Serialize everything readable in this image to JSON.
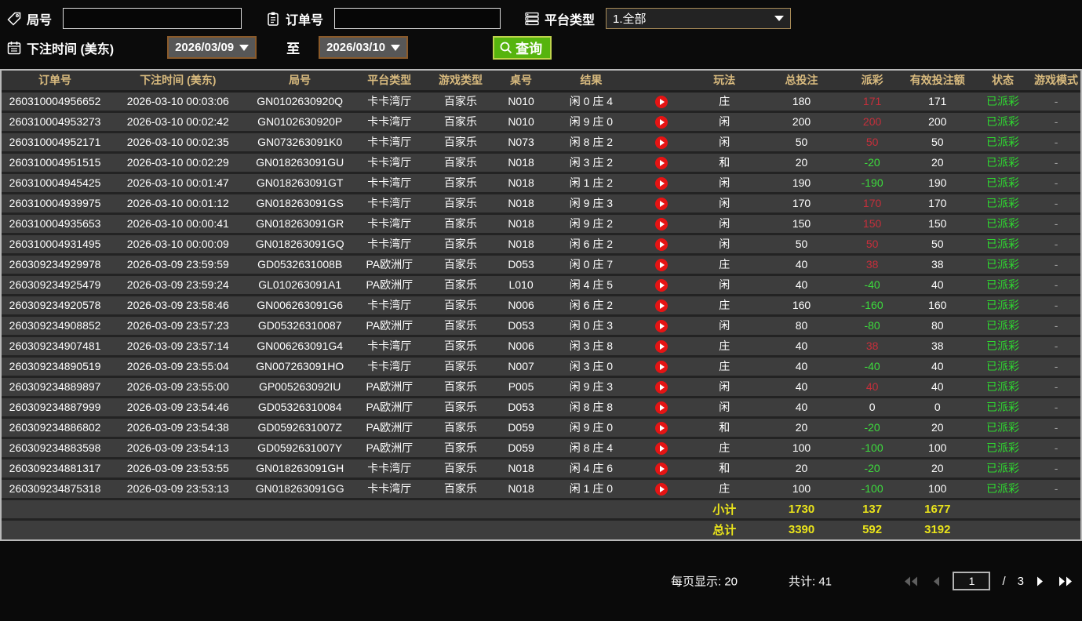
{
  "toolbar": {
    "round_label": "局号",
    "round_value": "",
    "order_label": "订单号",
    "order_value": "",
    "platform_label": "平台类型",
    "platform_selected": "1.全部",
    "bet_time_label": "下注时间 (美东)",
    "date_from": "2026/03/09",
    "to_label": "至",
    "date_to": "2026/03/10",
    "search_label": "查询"
  },
  "table": {
    "headers": [
      "订单号",
      "下注时间 (美东)",
      "局号",
      "平台类型",
      "游戏类型",
      "桌号",
      "结果",
      "玩法",
      "总投注",
      "派彩",
      "有效投注额",
      "状态",
      "游戏模式"
    ],
    "rows": [
      {
        "order_no": "260310004956652",
        "bet_time": "2026-03-10 00:03:06",
        "round_no": "GN0102630920Q",
        "platform": "卡卡湾厅",
        "game_type": "百家乐",
        "table_no": "N010",
        "result": "闲 0 庄 4",
        "bet_type": "庄",
        "total_bet": "180",
        "payout": "171",
        "payout_class": "pos",
        "valid_bet": "171",
        "status": "已派彩",
        "mode": "-"
      },
      {
        "order_no": "260310004953273",
        "bet_time": "2026-03-10 00:02:42",
        "round_no": "GN0102630920P",
        "platform": "卡卡湾厅",
        "game_type": "百家乐",
        "table_no": "N010",
        "result": "闲 9 庄 0",
        "bet_type": "闲",
        "total_bet": "200",
        "payout": "200",
        "payout_class": "pos",
        "valid_bet": "200",
        "status": "已派彩",
        "mode": "-"
      },
      {
        "order_no": "260310004952171",
        "bet_time": "2026-03-10 00:02:35",
        "round_no": "GN073263091K0",
        "platform": "卡卡湾厅",
        "game_type": "百家乐",
        "table_no": "N073",
        "result": "闲 8 庄 2",
        "bet_type": "闲",
        "total_bet": "50",
        "payout": "50",
        "payout_class": "pos",
        "valid_bet": "50",
        "status": "已派彩",
        "mode": "-"
      },
      {
        "order_no": "260310004951515",
        "bet_time": "2026-03-10 00:02:29",
        "round_no": "GN018263091GU",
        "platform": "卡卡湾厅",
        "game_type": "百家乐",
        "table_no": "N018",
        "result": "闲 3 庄 2",
        "bet_type": "和",
        "total_bet": "20",
        "payout": "-20",
        "payout_class": "neg",
        "valid_bet": "20",
        "status": "已派彩",
        "mode": "-"
      },
      {
        "order_no": "260310004945425",
        "bet_time": "2026-03-10 00:01:47",
        "round_no": "GN018263091GT",
        "platform": "卡卡湾厅",
        "game_type": "百家乐",
        "table_no": "N018",
        "result": "闲 1 庄 2",
        "bet_type": "闲",
        "total_bet": "190",
        "payout": "-190",
        "payout_class": "neg",
        "valid_bet": "190",
        "status": "已派彩",
        "mode": "-"
      },
      {
        "order_no": "260310004939975",
        "bet_time": "2026-03-10 00:01:12",
        "round_no": "GN018263091GS",
        "platform": "卡卡湾厅",
        "game_type": "百家乐",
        "table_no": "N018",
        "result": "闲 9 庄 3",
        "bet_type": "闲",
        "total_bet": "170",
        "payout": "170",
        "payout_class": "pos",
        "valid_bet": "170",
        "status": "已派彩",
        "mode": "-"
      },
      {
        "order_no": "260310004935653",
        "bet_time": "2026-03-10 00:00:41",
        "round_no": "GN018263091GR",
        "platform": "卡卡湾厅",
        "game_type": "百家乐",
        "table_no": "N018",
        "result": "闲 9 庄 2",
        "bet_type": "闲",
        "total_bet": "150",
        "payout": "150",
        "payout_class": "pos",
        "valid_bet": "150",
        "status": "已派彩",
        "mode": "-"
      },
      {
        "order_no": "260310004931495",
        "bet_time": "2026-03-10 00:00:09",
        "round_no": "GN018263091GQ",
        "platform": "卡卡湾厅",
        "game_type": "百家乐",
        "table_no": "N018",
        "result": "闲 6 庄 2",
        "bet_type": "闲",
        "total_bet": "50",
        "payout": "50",
        "payout_class": "pos",
        "valid_bet": "50",
        "status": "已派彩",
        "mode": "-"
      },
      {
        "order_no": "260309234929978",
        "bet_time": "2026-03-09 23:59:59",
        "round_no": "GD0532631008B",
        "platform": "PA欧洲厅",
        "game_type": "百家乐",
        "table_no": "D053",
        "result": "闲 0 庄 7",
        "bet_type": "庄",
        "total_bet": "40",
        "payout": "38",
        "payout_class": "pos",
        "valid_bet": "38",
        "status": "已派彩",
        "mode": "-"
      },
      {
        "order_no": "260309234925479",
        "bet_time": "2026-03-09 23:59:24",
        "round_no": "GL010263091A1",
        "platform": "PA欧洲厅",
        "game_type": "百家乐",
        "table_no": "L010",
        "result": "闲 4 庄 5",
        "bet_type": "闲",
        "total_bet": "40",
        "payout": "-40",
        "payout_class": "neg",
        "valid_bet": "40",
        "status": "已派彩",
        "mode": "-"
      },
      {
        "order_no": "260309234920578",
        "bet_time": "2026-03-09 23:58:46",
        "round_no": "GN006263091G6",
        "platform": "卡卡湾厅",
        "game_type": "百家乐",
        "table_no": "N006",
        "result": "闲 6 庄 2",
        "bet_type": "庄",
        "total_bet": "160",
        "payout": "-160",
        "payout_class": "neg",
        "valid_bet": "160",
        "status": "已派彩",
        "mode": "-"
      },
      {
        "order_no": "260309234908852",
        "bet_time": "2026-03-09 23:57:23",
        "round_no": "GD05326310087",
        "platform": "PA欧洲厅",
        "game_type": "百家乐",
        "table_no": "D053",
        "result": "闲 0 庄 3",
        "bet_type": "闲",
        "total_bet": "80",
        "payout": "-80",
        "payout_class": "neg",
        "valid_bet": "80",
        "status": "已派彩",
        "mode": "-"
      },
      {
        "order_no": "260309234907481",
        "bet_time": "2026-03-09 23:57:14",
        "round_no": "GN006263091G4",
        "platform": "卡卡湾厅",
        "game_type": "百家乐",
        "table_no": "N006",
        "result": "闲 3 庄 8",
        "bet_type": "庄",
        "total_bet": "40",
        "payout": "38",
        "payout_class": "pos",
        "valid_bet": "38",
        "status": "已派彩",
        "mode": "-"
      },
      {
        "order_no": "260309234890519",
        "bet_time": "2026-03-09 23:55:04",
        "round_no": "GN007263091HO",
        "platform": "卡卡湾厅",
        "game_type": "百家乐",
        "table_no": "N007",
        "result": "闲 3 庄 0",
        "bet_type": "庄",
        "total_bet": "40",
        "payout": "-40",
        "payout_class": "neg",
        "valid_bet": "40",
        "status": "已派彩",
        "mode": "-"
      },
      {
        "order_no": "260309234889897",
        "bet_time": "2026-03-09 23:55:00",
        "round_no": "GP005263092IU",
        "platform": "PA欧洲厅",
        "game_type": "百家乐",
        "table_no": "P005",
        "result": "闲 9 庄 3",
        "bet_type": "闲",
        "total_bet": "40",
        "payout": "40",
        "payout_class": "pos",
        "valid_bet": "40",
        "status": "已派彩",
        "mode": "-"
      },
      {
        "order_no": "260309234887999",
        "bet_time": "2026-03-09 23:54:46",
        "round_no": "GD05326310084",
        "platform": "PA欧洲厅",
        "game_type": "百家乐",
        "table_no": "D053",
        "result": "闲 8 庄 8",
        "bet_type": "闲",
        "total_bet": "40",
        "payout": "0",
        "payout_class": "zero",
        "valid_bet": "0",
        "status": "已派彩",
        "mode": "-"
      },
      {
        "order_no": "260309234886802",
        "bet_time": "2026-03-09 23:54:38",
        "round_no": "GD0592631007Z",
        "platform": "PA欧洲厅",
        "game_type": "百家乐",
        "table_no": "D059",
        "result": "闲 9 庄 0",
        "bet_type": "和",
        "total_bet": "20",
        "payout": "-20",
        "payout_class": "neg",
        "valid_bet": "20",
        "status": "已派彩",
        "mode": "-"
      },
      {
        "order_no": "260309234883598",
        "bet_time": "2026-03-09 23:54:13",
        "round_no": "GD0592631007Y",
        "platform": "PA欧洲厅",
        "game_type": "百家乐",
        "table_no": "D059",
        "result": "闲 8 庄 4",
        "bet_type": "庄",
        "total_bet": "100",
        "payout": "-100",
        "payout_class": "neg",
        "valid_bet": "100",
        "status": "已派彩",
        "mode": "-"
      },
      {
        "order_no": "260309234881317",
        "bet_time": "2026-03-09 23:53:55",
        "round_no": "GN018263091GH",
        "platform": "卡卡湾厅",
        "game_type": "百家乐",
        "table_no": "N018",
        "result": "闲 4 庄 6",
        "bet_type": "和",
        "total_bet": "20",
        "payout": "-20",
        "payout_class": "neg",
        "valid_bet": "20",
        "status": "已派彩",
        "mode": "-"
      },
      {
        "order_no": "260309234875318",
        "bet_time": "2026-03-09 23:53:13",
        "round_no": "GN018263091GG",
        "platform": "卡卡湾厅",
        "game_type": "百家乐",
        "table_no": "N018",
        "result": "闲 1 庄 0",
        "bet_type": "庄",
        "total_bet": "100",
        "payout": "-100",
        "payout_class": "neg",
        "valid_bet": "100",
        "status": "已派彩",
        "mode": "-"
      }
    ],
    "subtotal": {
      "label": "小计",
      "total_bet": "1730",
      "payout": "137",
      "valid_bet": "1677"
    },
    "total": {
      "label": "总计",
      "total_bet": "3390",
      "payout": "592",
      "valid_bet": "3192"
    }
  },
  "footer": {
    "per_page_label": "每页显示:",
    "per_page_value": "20",
    "total_count_label": "共计:",
    "total_count_value": "41",
    "page_input": "1",
    "page_separator": "/",
    "page_total": "3"
  },
  "colors": {
    "header_text_gold": "#d8ba7e",
    "payout_positive_red": "#c62f3b",
    "payout_negative_green": "#3ddc3d",
    "status_paid_green": "#2fd930",
    "summary_yellow": "#e9e31b",
    "search_button_green": "#56b40e",
    "play_icon_red": "#e51414",
    "date_button_border_brown": "#8a5a2a"
  }
}
